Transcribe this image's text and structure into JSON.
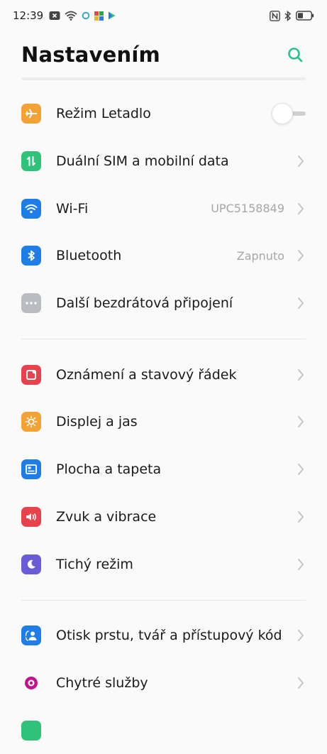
{
  "status_bar": {
    "time": "12:39",
    "icons_left": [
      "notification-x-icon",
      "wifi-icon",
      "ring-icon",
      "puzzle-icon",
      "play-icon"
    ],
    "icons_right": [
      "nfc-icon",
      "bluetooth-icon",
      "battery-icon"
    ]
  },
  "header": {
    "title": "Nastavením",
    "search_icon": "search-icon"
  },
  "colors": {
    "accent": "#2ac28f",
    "airplane": "#f4a234",
    "sim": "#2fc37a",
    "wifi": "#1f7de8",
    "bluetooth": "#1f7de8",
    "more": "#b9bcc3",
    "notifications": "#e8424c",
    "display": "#f4a234",
    "wallpaper": "#1f7de8",
    "sound": "#e8424c",
    "silent": "#6a5bd6",
    "fingerprint": "#1f7de8",
    "smart": "#c4138a"
  },
  "items": [
    {
      "label": "Režim Letadlo",
      "icon": "airplane-icon",
      "control": "toggle",
      "toggle_on": false
    },
    {
      "label": "Duální SIM a mobilní data",
      "icon": "sim-icon"
    },
    {
      "label": "Wi-Fi",
      "icon": "wifi-icon",
      "value": "UPC5158849"
    },
    {
      "label": "Bluetooth",
      "icon": "bluetooth-icon",
      "value": "Zapnuto"
    },
    {
      "label": "Další bezdrátová připojení",
      "icon": "more-icon"
    },
    {
      "label": "Oznámení a stavový řádek",
      "icon": "notification-icon"
    },
    {
      "label": "Displej a jas",
      "icon": "brightness-icon"
    },
    {
      "label": "Plocha a tapeta",
      "icon": "wallpaper-icon"
    },
    {
      "label": "Zvuk a vibrace",
      "icon": "sound-icon"
    },
    {
      "label": "Tichý režim",
      "icon": "moon-icon"
    },
    {
      "label": "Otisk prstu, tvář a přístupový kód",
      "icon": "fingerprint-icon"
    },
    {
      "label": "Chytré služby",
      "icon": "smart-services-icon"
    }
  ]
}
